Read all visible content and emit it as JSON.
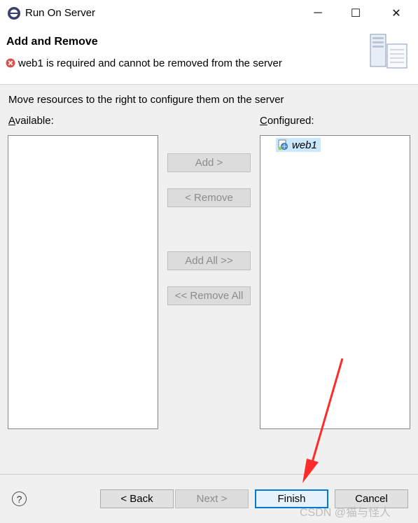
{
  "window": {
    "title": "Run On Server",
    "minimize": "─",
    "maximize": "☐",
    "close": "✕"
  },
  "header": {
    "title": "Add and Remove",
    "error": "web1 is required and cannot be removed from the server"
  },
  "instruction": "Move resources to the right to configure them on the server",
  "available": {
    "prefix": "",
    "underline": "A",
    "rest": "vailable:",
    "items": []
  },
  "configured": {
    "underline": "C",
    "rest": "onfigured:",
    "items": [
      "web1"
    ]
  },
  "buttons": {
    "add": "Add >",
    "remove": "< Remove",
    "add_all": "Add All >>",
    "remove_all": "<< Remove All"
  },
  "footer": {
    "help": "?",
    "back": "< Back",
    "next": "Next >",
    "finish": "Finish",
    "cancel": "Cancel"
  },
  "watermark": "CSDN @猫与怪人",
  "colors": {
    "error": "#d9534f",
    "selection": "#cce8ff",
    "annotation_arrow": "#ff2a2a"
  }
}
